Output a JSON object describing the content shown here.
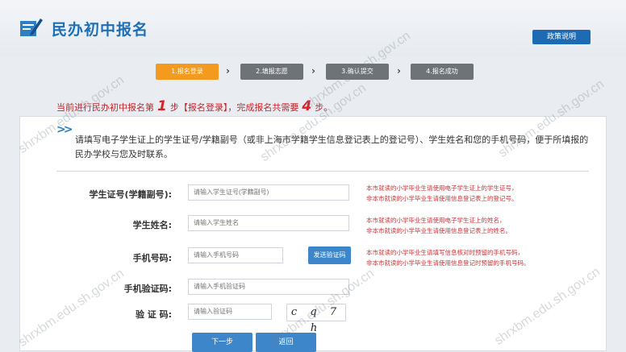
{
  "header": {
    "title": "民办初中报名",
    "guide_button": "政策说明"
  },
  "steps": [
    {
      "label": "1.报名登录",
      "active": true
    },
    {
      "label": "2.填报志愿",
      "active": false
    },
    {
      "label": "3.确认提交",
      "active": false
    },
    {
      "label": "4.报名成功",
      "active": false
    }
  ],
  "progress": {
    "prefix": "当前进行民办初中报名第",
    "current": "1",
    "middle": "步【报名登录】，完成报名共需要",
    "total": "4",
    "suffix": "步。"
  },
  "intro": {
    "icon": "double-chevron-right-icon",
    "text": "请填写电子学生证上的学生证号/学籍副号（或非上海市学籍学生信息登记表上的登记号）、学生姓名和您的手机号码，便于所填报的民办学校与您及时联系。"
  },
  "form": {
    "student_id": {
      "label": "学生证号(学籍副号):",
      "placeholder": "请输入学生证号(学籍副号)",
      "hint1": "本市就读的小学毕业生请使用电子学生证上的学生证号，",
      "hint2": "非本市就读的小学毕业生请使用信息登记表上的登记号。"
    },
    "name": {
      "label": "学生姓名:",
      "placeholder": "请输入学生姓名",
      "hint1": "本市就读的小学毕业生请使用电子学生证上的姓名，",
      "hint2": "非本市就读的小学毕业生请使用信息登记表上的姓名。"
    },
    "phone": {
      "label": "手机号码:",
      "placeholder": "请输入手机号码",
      "send_button": "发送验证码",
      "hint1": "本市就读的小学毕业生请填写信息核对时预留的手机号码，",
      "hint2": "非本市就读的小学毕业生请使用信息登记时预留的手机号码。"
    },
    "sms_code": {
      "label": "手机验证码:",
      "placeholder": "请输入手机验证码"
    },
    "captcha": {
      "label": "验 证 码:",
      "placeholder": "请输入验证码",
      "image_text": "c q 7 h"
    }
  },
  "buttons": {
    "next": "下一步",
    "back": "返回"
  },
  "watermark": "shrxbm.edu.sh.gov.cn",
  "colors": {
    "accent": "#1c6bb3",
    "active_step": "#f39a1f",
    "inactive_step": "#6e7378",
    "hint": "#c8343a"
  }
}
